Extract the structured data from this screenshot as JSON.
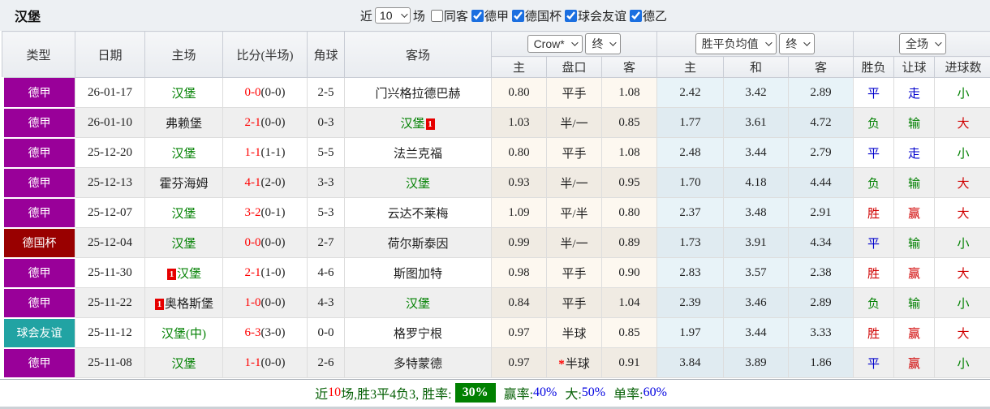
{
  "palette": {
    "league_bundesliga": "#990099",
    "league_dfb_pokal": "#990000",
    "league_club_friendly": "#21a3a3",
    "team_highlight_green": "#008000",
    "score_red": "#ff0000",
    "result_red": "#d00000",
    "result_blue": "#0000cc",
    "result_green": "#008000",
    "win_rate_badge_bg": "#008000",
    "summary_label_green": "#066006",
    "summary_percent_blue": "#0000e0",
    "checkbox_blue": "#1b6fe0"
  },
  "topbar": {
    "title": "汉堡",
    "near_label": "近",
    "recent_count": "10",
    "matches_label": "场",
    "filters": [
      {
        "label": "同客",
        "checked": false
      },
      {
        "label": "德甲",
        "checked": true
      },
      {
        "label": "德国杯",
        "checked": true
      },
      {
        "label": "球会友谊",
        "checked": true
      },
      {
        "label": "德乙",
        "checked": true
      }
    ]
  },
  "header": {
    "columns": [
      "类型",
      "日期",
      "主场",
      "比分(半场)",
      "角球",
      "客场"
    ],
    "odds_group": {
      "select1": "Crow*",
      "select2": "终",
      "sub": [
        "主",
        "盘口",
        "客"
      ]
    },
    "mean_group": {
      "select1": "胜平负均值",
      "select2": "终",
      "sub": [
        "主",
        "和",
        "客"
      ]
    },
    "result_group": {
      "select1": "全场",
      "sub": [
        "胜负",
        "让球",
        "进球数"
      ]
    }
  },
  "rows": [
    {
      "league": "德甲",
      "league_key": "bundesliga",
      "date": "26-01-17",
      "home": {
        "name": "汉堡",
        "highlight": true
      },
      "score": {
        "full": "0-0",
        "half": "(0-0)"
      },
      "corner": "2-5",
      "away": {
        "name": "门兴格拉德巴赫",
        "highlight": false
      },
      "odds": {
        "home": "0.80",
        "handicap": "平手",
        "away": "1.08",
        "star": false
      },
      "mean": {
        "home": "2.42",
        "draw": "3.42",
        "away": "2.89"
      },
      "result": {
        "outcome": {
          "text": "平",
          "cls": "blue"
        },
        "handicap": {
          "text": "走",
          "cls": "blue"
        },
        "goals": {
          "text": "小",
          "cls": "green"
        }
      }
    },
    {
      "league": "德甲",
      "league_key": "bundesliga",
      "date": "26-01-10",
      "home": {
        "name": "弗赖堡",
        "highlight": false
      },
      "score": {
        "full": "2-1",
        "half": "(0-0)"
      },
      "corner": "0-3",
      "away": {
        "name": "汉堡",
        "highlight": true,
        "badge": "1",
        "badge_pos": "after"
      },
      "odds": {
        "home": "1.03",
        "handicap": "半/一",
        "away": "0.85",
        "star": false
      },
      "mean": {
        "home": "1.77",
        "draw": "3.61",
        "away": "4.72"
      },
      "result": {
        "outcome": {
          "text": "负",
          "cls": "green"
        },
        "handicap": {
          "text": "输",
          "cls": "green"
        },
        "goals": {
          "text": "大",
          "cls": "red"
        }
      }
    },
    {
      "league": "德甲",
      "league_key": "bundesliga",
      "date": "25-12-20",
      "home": {
        "name": "汉堡",
        "highlight": true
      },
      "score": {
        "full": "1-1",
        "half": "(1-1)"
      },
      "corner": "5-5",
      "away": {
        "name": "法兰克福",
        "highlight": false
      },
      "odds": {
        "home": "0.80",
        "handicap": "平手",
        "away": "1.08",
        "star": false
      },
      "mean": {
        "home": "2.48",
        "draw": "3.44",
        "away": "2.79"
      },
      "result": {
        "outcome": {
          "text": "平",
          "cls": "blue"
        },
        "handicap": {
          "text": "走",
          "cls": "blue"
        },
        "goals": {
          "text": "小",
          "cls": "green"
        }
      }
    },
    {
      "league": "德甲",
      "league_key": "bundesliga",
      "date": "25-12-13",
      "home": {
        "name": "霍芬海姆",
        "highlight": false
      },
      "score": {
        "full": "4-1",
        "half": "(2-0)"
      },
      "corner": "3-3",
      "away": {
        "name": "汉堡",
        "highlight": true
      },
      "odds": {
        "home": "0.93",
        "handicap": "半/一",
        "away": "0.95",
        "star": false
      },
      "mean": {
        "home": "1.70",
        "draw": "4.18",
        "away": "4.44"
      },
      "result": {
        "outcome": {
          "text": "负",
          "cls": "green"
        },
        "handicap": {
          "text": "输",
          "cls": "green"
        },
        "goals": {
          "text": "大",
          "cls": "red"
        }
      }
    },
    {
      "league": "德甲",
      "league_key": "bundesliga",
      "date": "25-12-07",
      "home": {
        "name": "汉堡",
        "highlight": true
      },
      "score": {
        "full": "3-2",
        "half": "(0-1)"
      },
      "corner": "5-3",
      "away": {
        "name": "云达不莱梅",
        "highlight": false
      },
      "odds": {
        "home": "1.09",
        "handicap": "平/半",
        "away": "0.80",
        "star": false
      },
      "mean": {
        "home": "2.37",
        "draw": "3.48",
        "away": "2.91"
      },
      "result": {
        "outcome": {
          "text": "胜",
          "cls": "red"
        },
        "handicap": {
          "text": "赢",
          "cls": "red"
        },
        "goals": {
          "text": "大",
          "cls": "red"
        }
      }
    },
    {
      "league": "德国杯",
      "league_key": "dfb_pokal",
      "date": "25-12-04",
      "home": {
        "name": "汉堡",
        "highlight": true
      },
      "score": {
        "full": "0-0",
        "half": "(0-0)"
      },
      "corner": "2-7",
      "away": {
        "name": "荷尔斯泰因",
        "highlight": false
      },
      "odds": {
        "home": "0.99",
        "handicap": "半/一",
        "away": "0.89",
        "star": false
      },
      "mean": {
        "home": "1.73",
        "draw": "3.91",
        "away": "4.34"
      },
      "result": {
        "outcome": {
          "text": "平",
          "cls": "blue"
        },
        "handicap": {
          "text": "输",
          "cls": "green"
        },
        "goals": {
          "text": "小",
          "cls": "green"
        }
      }
    },
    {
      "league": "德甲",
      "league_key": "bundesliga",
      "date": "25-11-30",
      "home": {
        "name": "汉堡",
        "highlight": true,
        "badge": "1",
        "badge_pos": "before"
      },
      "score": {
        "full": "2-1",
        "half": "(1-0)"
      },
      "corner": "4-6",
      "away": {
        "name": "斯图加特",
        "highlight": false
      },
      "odds": {
        "home": "0.98",
        "handicap": "平手",
        "away": "0.90",
        "star": false
      },
      "mean": {
        "home": "2.83",
        "draw": "3.57",
        "away": "2.38"
      },
      "result": {
        "outcome": {
          "text": "胜",
          "cls": "red"
        },
        "handicap": {
          "text": "赢",
          "cls": "red"
        },
        "goals": {
          "text": "大",
          "cls": "red"
        }
      }
    },
    {
      "league": "德甲",
      "league_key": "bundesliga",
      "date": "25-11-22",
      "home": {
        "name": "奥格斯堡",
        "highlight": false,
        "badge": "1",
        "badge_pos": "before"
      },
      "score": {
        "full": "1-0",
        "half": "(0-0)"
      },
      "corner": "4-3",
      "away": {
        "name": "汉堡",
        "highlight": true
      },
      "odds": {
        "home": "0.84",
        "handicap": "平手",
        "away": "1.04",
        "star": false
      },
      "mean": {
        "home": "2.39",
        "draw": "3.46",
        "away": "2.89"
      },
      "result": {
        "outcome": {
          "text": "负",
          "cls": "green"
        },
        "handicap": {
          "text": "输",
          "cls": "green"
        },
        "goals": {
          "text": "小",
          "cls": "green"
        }
      }
    },
    {
      "league": "球会友谊",
      "league_key": "club_friendly",
      "date": "25-11-12",
      "home": {
        "name": "汉堡(中)",
        "highlight": true
      },
      "score": {
        "full": "6-3",
        "half": "(3-0)"
      },
      "corner": "0-0",
      "away": {
        "name": "格罗宁根",
        "highlight": false
      },
      "odds": {
        "home": "0.97",
        "handicap": "半球",
        "away": "0.85",
        "star": false
      },
      "mean": {
        "home": "1.97",
        "draw": "3.44",
        "away": "3.33"
      },
      "result": {
        "outcome": {
          "text": "胜",
          "cls": "red"
        },
        "handicap": {
          "text": "赢",
          "cls": "red"
        },
        "goals": {
          "text": "大",
          "cls": "red"
        }
      }
    },
    {
      "league": "德甲",
      "league_key": "bundesliga",
      "date": "25-11-08",
      "home": {
        "name": "汉堡",
        "highlight": true
      },
      "score": {
        "full": "1-1",
        "half": "(0-0)"
      },
      "corner": "2-6",
      "away": {
        "name": "多特蒙德",
        "highlight": false
      },
      "odds": {
        "home": "0.97",
        "handicap": "半球",
        "away": "0.91",
        "star": true
      },
      "mean": {
        "home": "3.84",
        "draw": "3.89",
        "away": "1.86"
      },
      "result": {
        "outcome": {
          "text": "平",
          "cls": "blue"
        },
        "handicap": {
          "text": "赢",
          "cls": "red"
        },
        "goals": {
          "text": "小",
          "cls": "green"
        }
      }
    }
  ],
  "summary": {
    "prefix": "近",
    "count": "10",
    "mid": "场,胜3平4负3, 胜率:",
    "win_rate": "30%",
    "items": [
      {
        "label": "赢率:",
        "value": "40%"
      },
      {
        "label": "大:",
        "value": "50%"
      },
      {
        "label": "单率:",
        "value": "60%"
      }
    ]
  }
}
